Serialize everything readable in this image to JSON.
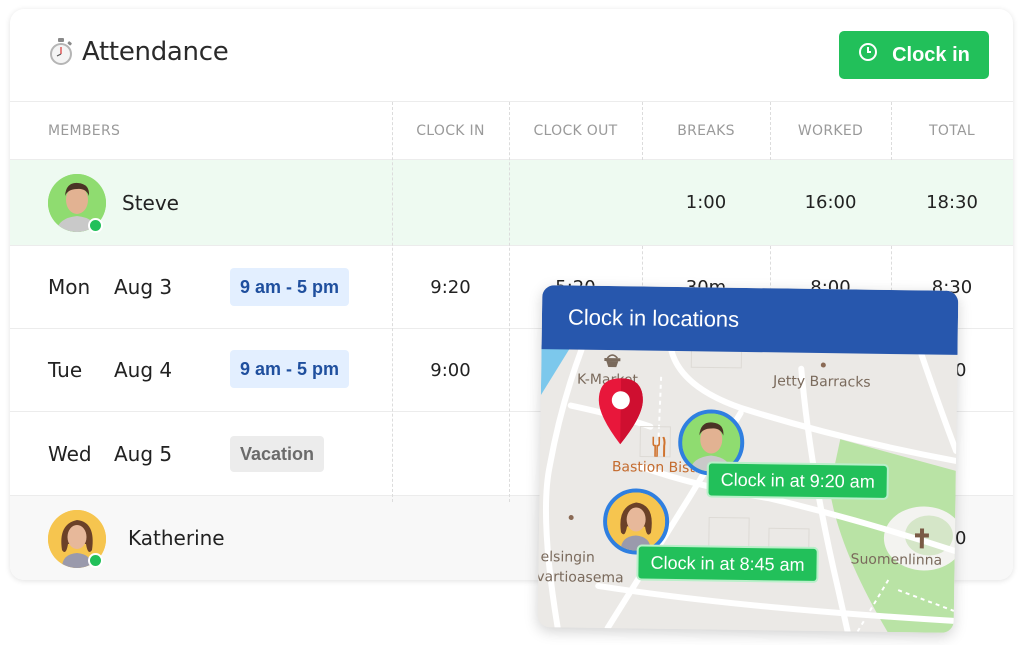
{
  "header": {
    "title": "Attendance",
    "title_icon": "stopwatch-icon",
    "clock_in_button": {
      "label": "Clock in",
      "icon": "clock-icon"
    }
  },
  "table": {
    "columns": [
      "MEMBERS",
      "CLOCK IN",
      "CLOCK OUT",
      "BREAKS",
      "WORKED",
      "TOTAL"
    ],
    "members": [
      {
        "name": "Steve",
        "status": "online",
        "breaks": "1:00",
        "worked": "16:00",
        "total": "18:30",
        "days": [
          {
            "day": "Mon",
            "date": "Aug 3",
            "shift": "9 am - 5 pm",
            "shift_type": "work",
            "clock_in": "9:20",
            "clock_out": "5:20",
            "breaks": "30m",
            "worked": "8:00",
            "total": "8:30"
          },
          {
            "day": "Tue",
            "date": "Aug 4",
            "shift": "9 am - 5 pm",
            "shift_type": "work",
            "clock_in": "9:00",
            "clock_out": "",
            "breaks": "",
            "worked": "",
            "total": ":00"
          },
          {
            "day": "Wed",
            "date": "Aug 5",
            "shift": "Vacation",
            "shift_type": "vacation",
            "clock_in": "",
            "clock_out": "",
            "breaks": "",
            "worked": "",
            "total": ""
          }
        ]
      },
      {
        "name": "Katherine",
        "status": "online",
        "breaks": "",
        "worked": "",
        "total": ":00"
      }
    ]
  },
  "popover": {
    "title": "Clock in locations",
    "map_labels": [
      "K-Market",
      "Jetty Barracks",
      "Bastion Bistr",
      "elsingin",
      "vartioasema",
      "Suomenlinna"
    ],
    "badges": [
      "Clock in at 9:20 am",
      "Clock in at 8:45 am"
    ]
  },
  "colors": {
    "accent_green": "#22c05a",
    "popover_blue": "#2757ad",
    "member_row_bg": "#eefaf1",
    "shift_tag_bg": "#e3efff",
    "shift_tag_text": "#1f4f9e",
    "pin_red": "#e8173b"
  }
}
